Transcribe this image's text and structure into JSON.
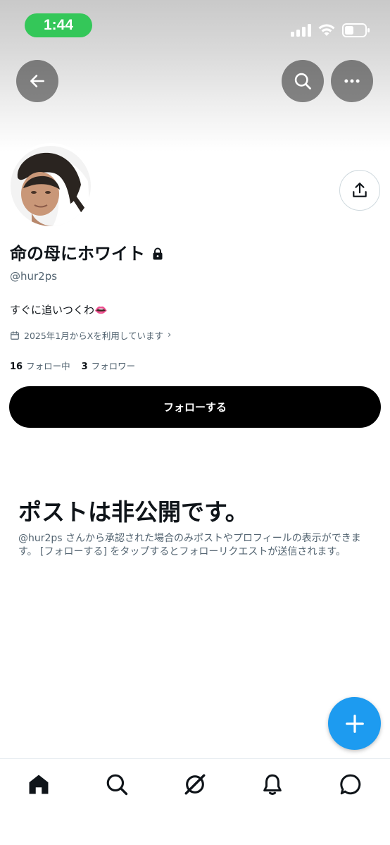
{
  "status_bar": {
    "time": "1:44",
    "icons": [
      "cellular-signal-icon",
      "wifi-icon",
      "battery-icon"
    ]
  },
  "nav": {
    "icons": [
      "back-arrow-icon",
      "search-icon",
      "more-icon"
    ]
  },
  "profile": {
    "display_name": "命の母にホワイト",
    "handle": "@hur2ps",
    "bio": "すぐに追いつくわ👄",
    "joined": "2025年1月からXを利用しています",
    "following_count": "16",
    "following_label": "フォロー中",
    "followers_count": "3",
    "followers_label": "フォロワー"
  },
  "follow_button_label": "フォローする",
  "private_notice": {
    "title": "ポストは非公開です。",
    "description": "@hur2ps さんから承認された場合のみポストやプロフィールの表示ができます。 [フォローする] をタップするとフォローリクエストが送信されます。"
  },
  "tabs": [
    "home-icon",
    "explore-icon",
    "grok-icon",
    "notifications-icon",
    "messages-icon"
  ],
  "colors": {
    "accent": "#1d9bf0",
    "status_time_pill": "#34c759",
    "text_primary": "#0f1419",
    "text_secondary": "#536471"
  }
}
